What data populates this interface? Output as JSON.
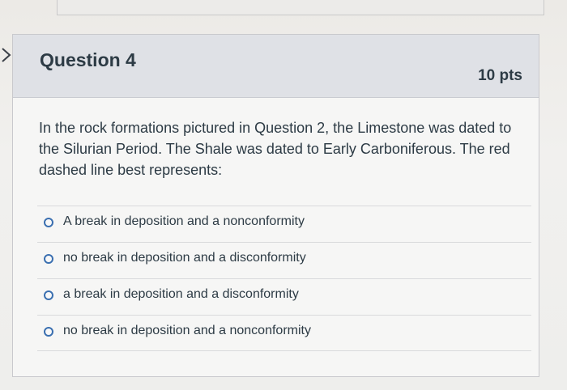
{
  "question": {
    "title": "Question 4",
    "points": "10 pts",
    "text": "In the rock formations pictured in Question 2, the Limestone was dated to the Silurian Period. The Shale was dated to Early Carboniferous. The red dashed line best represents:"
  },
  "answers": [
    {
      "label": "A break in deposition and a nonconformity"
    },
    {
      "label": "no break in deposition and a disconformity"
    },
    {
      "label": "a break in deposition and a disconformity"
    },
    {
      "label": "no break in deposition and a nonconformity"
    }
  ],
  "icons": {
    "collapse": "chevron-right-icon",
    "answer_option": "radio-button-icon"
  },
  "colors": {
    "header_background": "#dfe1e6",
    "text": "#2d3b45",
    "radio_border": "#3a6fb0"
  }
}
